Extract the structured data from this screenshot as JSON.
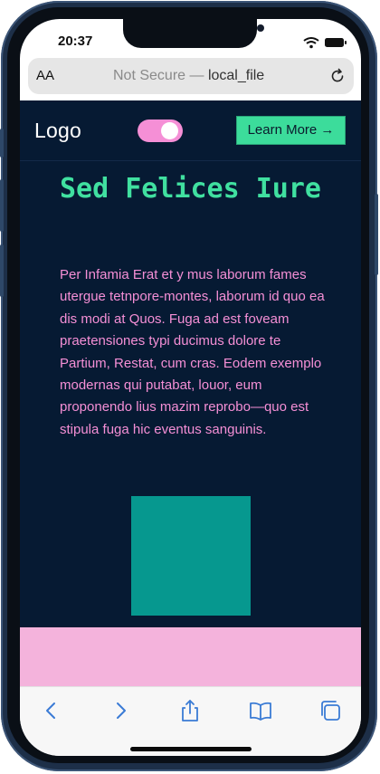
{
  "status_bar": {
    "time": "20:37",
    "icons": [
      "signal-icon",
      "wifi-icon",
      "battery-icon"
    ]
  },
  "browser": {
    "text_size_label": "AA",
    "security_label": "Not Secure —",
    "url": "local_file",
    "reload_icon": "reload-icon"
  },
  "site": {
    "logo": "Logo",
    "toggle_state": "on",
    "cta_label": "Learn More →",
    "hero_title": "Sed Felices Iure",
    "hero_body": "Per Infamia Erat et y mus laborum fames utergue tetnpore-montes, laborum id quo ea dis modi at Quos. Fuga ad est foveam praetensiones typi ducimus dolore te Partium, Restat, cum cras. Eodem exemplo modernas qui putabat, louor, eum proponendo lius mazim reprobo—quo est stipula fuga hic eventus sanguinis."
  },
  "toolbar": {
    "items": [
      "back-icon",
      "forward-icon",
      "share-icon",
      "bookmarks-icon",
      "tabs-icon"
    ]
  },
  "colors": {
    "page_bg": "#061a33",
    "accent_green": "#40e0a0",
    "accent_pink": "#f58fd6",
    "teal_block": "#06988f",
    "pink_band": "#f4b3dc"
  }
}
